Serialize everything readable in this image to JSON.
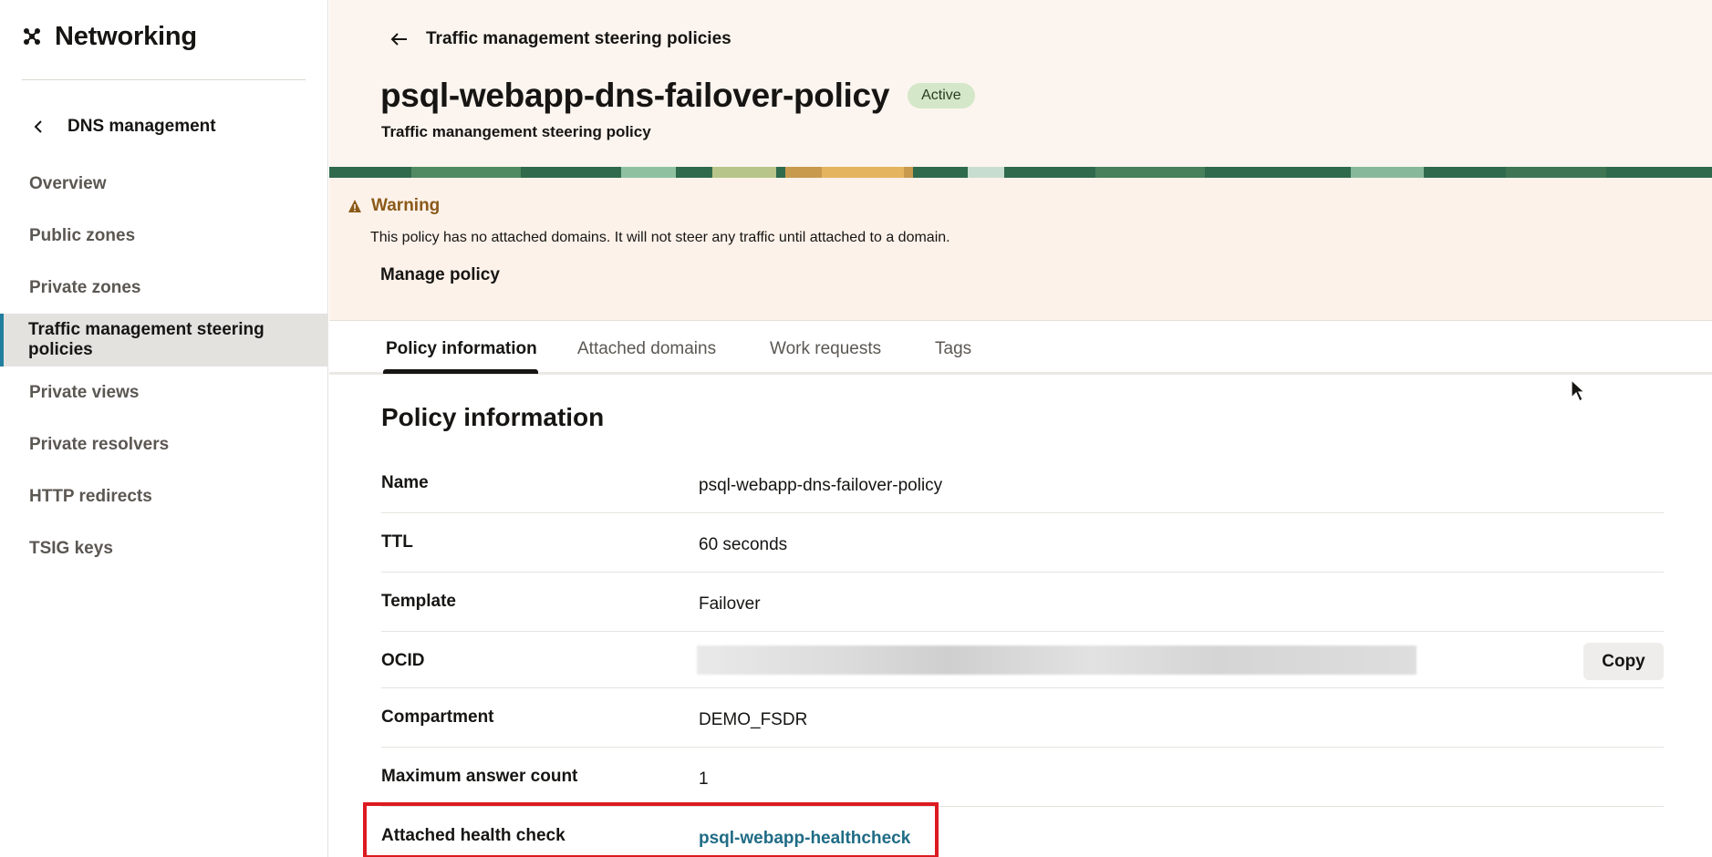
{
  "app": {
    "title": "Networking",
    "back_label": "DNS management"
  },
  "sidebar": {
    "items": [
      {
        "label": "Overview"
      },
      {
        "label": "Public zones"
      },
      {
        "label": "Private zones"
      },
      {
        "label": "Traffic management steering policies"
      },
      {
        "label": "Private views"
      },
      {
        "label": "Private resolvers"
      },
      {
        "label": "HTTP redirects"
      },
      {
        "label": "TSIG keys"
      }
    ]
  },
  "header": {
    "breadcrumb": "Traffic management steering policies",
    "title": "psql-webapp-dns-failover-policy",
    "status": "Active",
    "subtitle": "Traffic manangement steering policy"
  },
  "warning": {
    "title": "Warning",
    "message": "This policy has no attached domains. It will not steer any traffic until attached to a domain.",
    "action_label": "Manage policy"
  },
  "tabs": [
    {
      "label": "Policy information"
    },
    {
      "label": "Attached domains"
    },
    {
      "label": "Work requests"
    },
    {
      "label": "Tags"
    }
  ],
  "policy": {
    "section_title": "Policy information",
    "rows": [
      {
        "label": "Name",
        "value": "psql-webapp-dns-failover-policy"
      },
      {
        "label": "TTL",
        "value": "60 seconds"
      },
      {
        "label": "Template",
        "value": "Failover"
      },
      {
        "label": "OCID",
        "value": ""
      },
      {
        "label": "Compartment",
        "value": "DEMO_FSDR"
      },
      {
        "label": "Maximum answer count",
        "value": "1"
      },
      {
        "label": "Attached health check",
        "value": "psql-webapp-healthcheck"
      }
    ],
    "copy_label": "Copy"
  },
  "colors": {
    "accent": "#227e9e",
    "link": "#1f6b85",
    "header_bg": "#fcf5ef",
    "warning_bg": "#fdf2ea",
    "badge_bg": "#d4e7c8",
    "highlight": "#dd1a21"
  },
  "icons": {
    "brand": "networking-icon",
    "back": "chevron-left-icon",
    "breadcrumb": "arrow-left-icon",
    "warning": "warning-triangle-icon",
    "cursor": "mouse-cursor-icon"
  }
}
